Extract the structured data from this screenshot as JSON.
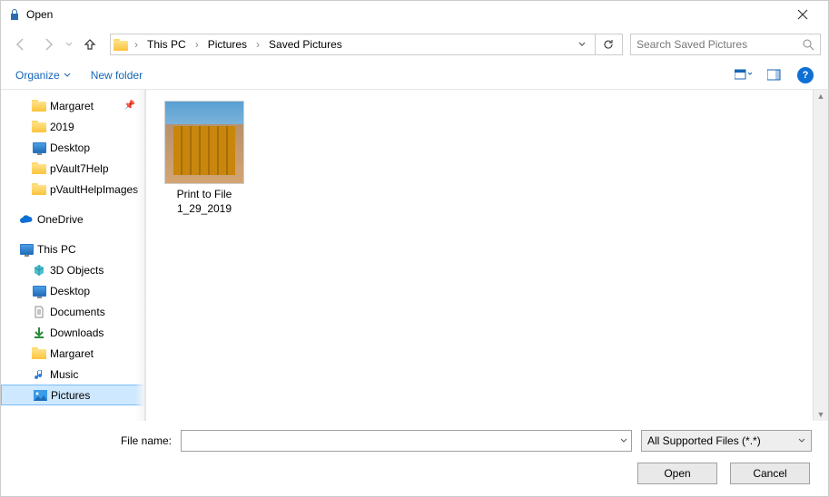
{
  "title": "Open",
  "breadcrumbs": [
    "This PC",
    "Pictures",
    "Saved Pictures"
  ],
  "search": {
    "placeholder": "Search Saved Pictures"
  },
  "toolbar": {
    "organize": "Organize",
    "newfolder": "New folder"
  },
  "tree": {
    "quickAccess": [
      {
        "label": "Margaret",
        "icon": "folder",
        "pinned": true
      },
      {
        "label": "2019",
        "icon": "folder"
      },
      {
        "label": "Desktop",
        "icon": "desktop"
      },
      {
        "label": "pVault7Help",
        "icon": "folder"
      },
      {
        "label": "pVaultHelpImages",
        "icon": "folder"
      }
    ],
    "onedrive": {
      "label": "OneDrive"
    },
    "thispc": {
      "label": "This PC",
      "children": [
        {
          "label": "3D Objects",
          "icon": "3d"
        },
        {
          "label": "Desktop",
          "icon": "desktop"
        },
        {
          "label": "Documents",
          "icon": "documents"
        },
        {
          "label": "Downloads",
          "icon": "downloads"
        },
        {
          "label": "Margaret",
          "icon": "folder"
        },
        {
          "label": "Music",
          "icon": "music"
        },
        {
          "label": "Pictures",
          "icon": "pictures",
          "selected": true
        }
      ]
    }
  },
  "files": [
    {
      "name_line1": "Print to File",
      "name_line2": "1_29_2019"
    }
  ],
  "bottom": {
    "filename_label": "File name:",
    "filetype": "All Supported Files (*.*)",
    "open": "Open",
    "cancel": "Cancel"
  }
}
